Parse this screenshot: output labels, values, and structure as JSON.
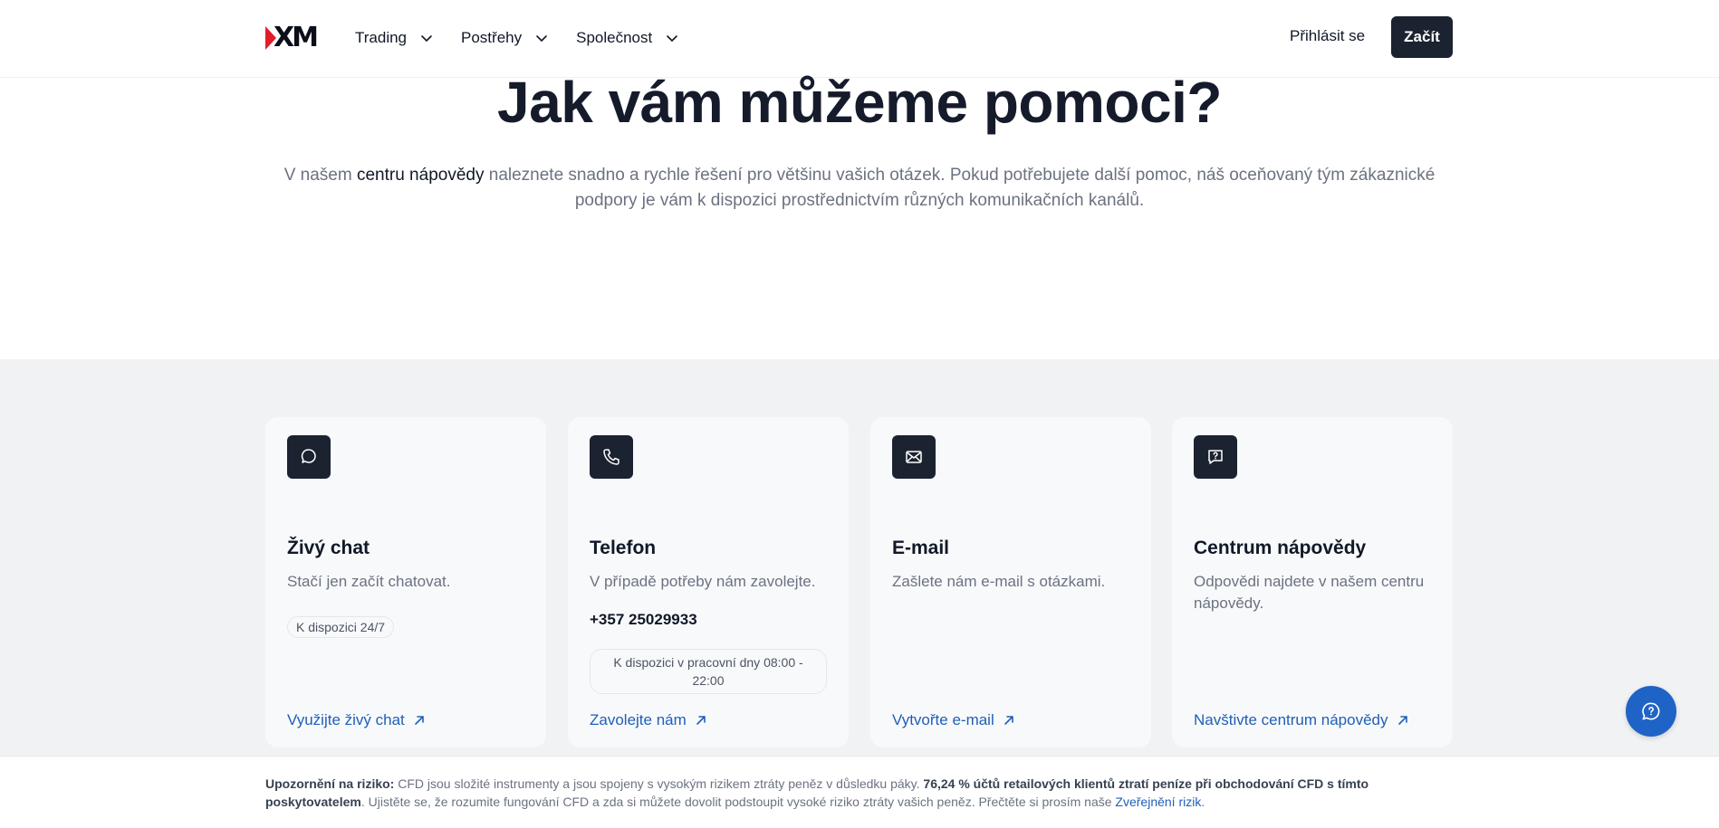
{
  "header": {
    "logo_text": "XM",
    "nav": [
      {
        "label": "Trading"
      },
      {
        "label": "Postřehy"
      },
      {
        "label": "Společnost"
      }
    ],
    "login_label": "Přihlásit se",
    "start_label": "Začít"
  },
  "hero": {
    "title": "Jak vám můžeme pomoci?",
    "text_before": "V našem ",
    "text_link": "centru nápovědy",
    "text_after": " naleznete snadno a rychle řešení pro většinu vašich otázek. Pokud potřebujete další pomoc, náš oceňovaný tým zákaznické podpory je vám k dispozici prostřednictvím různých komunikačních kanálů."
  },
  "cards": [
    {
      "icon": "chat-bubble-icon",
      "title": "Živý chat",
      "desc": "Stačí jen začít chatovat.",
      "badge": "K dispozici 24/7",
      "link": "Využijte živý chat"
    },
    {
      "icon": "phone-icon",
      "title": "Telefon",
      "desc": "V případě potřeby nám zavolejte.",
      "phone": "+357 25029933",
      "badge": "K dispozici v pracovní dny 08:00 - 22:00",
      "link": "Zavolejte nám"
    },
    {
      "icon": "envelope-icon",
      "title": "E-mail",
      "desc": "Zašlete nám e-mail s otázkami.",
      "link": "Vytvořte e-mail"
    },
    {
      "icon": "help-question-icon",
      "title": "Centrum nápovědy",
      "desc": "Odpovědi najdete v našem centru nápovědy.",
      "link": "Navštivte centrum nápovědy"
    }
  ],
  "risk": {
    "label": "Upozornění na riziko:",
    "text1": " CFD jsou složité instrumenty a jsou spojeny s vysokým rizikem ztráty peněz v důsledku páky. ",
    "bold": "76,24 % účtů retailových klientů ztratí peníze při obchodování CFD s tímto poskytovatelem",
    "text2": ". Ujistěte se, že rozumite fungování CFD a zda si můžete dovolit podstoupit vysoké riziko ztráty vašich peněz. Přečtěte si prosím naše ",
    "link": "Zveřejnění rizik",
    "end": "."
  },
  "colors": {
    "dark": "#1b2230",
    "link": "#1f5fb8",
    "fab": "#1f63c6",
    "section_bg": "#f1f2f4",
    "logo_red": "#e11d2a"
  }
}
